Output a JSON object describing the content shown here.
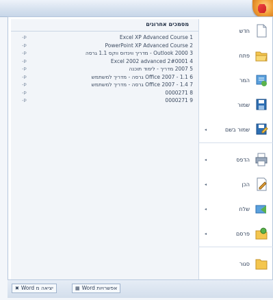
{
  "recent": {
    "header": "מסמכים אחרונים",
    "pin_label": "-Þ",
    "items": [
      {
        "num": "1",
        "text": "Excel XP Advanced Course"
      },
      {
        "num": "2",
        "text": "PowerPoint XP Advanced Course"
      },
      {
        "num": "3",
        "text": "Outlook 2000 - מדריך ווינדוס ווקס 1.1 גרסה"
      },
      {
        "num": "4",
        "text": "Excel 2002 advanced 2#0001"
      },
      {
        "num": "5",
        "text": "2007 מדריך - לימוד תוכנה"
      },
      {
        "num": "6",
        "text": "Office 2007 - 1.1 גרסה - מדריך למשתמש"
      },
      {
        "num": "7",
        "text": "Office 2007 - 1.4 גרסה - מדריך למשתמש"
      },
      {
        "num": "8",
        "text": "0000271"
      },
      {
        "num": "9",
        "text": "0000271"
      }
    ]
  },
  "menu": {
    "items": [
      {
        "label": "חדש",
        "icon": "new-document-icon",
        "has_arrow": false
      },
      {
        "label": "פתח",
        "icon": "open-folder-icon",
        "has_arrow": false
      },
      {
        "label": "המר",
        "icon": "convert-icon",
        "has_arrow": false
      },
      {
        "label": "שמור",
        "icon": "save-icon",
        "has_arrow": false
      },
      {
        "label": "שמור בשם",
        "icon": "save-as-icon",
        "has_arrow": true
      },
      {
        "label": "הדפס",
        "icon": "print-icon",
        "has_arrow": true
      },
      {
        "label": "הכן",
        "icon": "prepare-icon",
        "has_arrow": true
      },
      {
        "label": "שלח",
        "icon": "send-icon",
        "has_arrow": true
      },
      {
        "label": "פרסם",
        "icon": "publish-icon",
        "has_arrow": true
      },
      {
        "label": "סגור",
        "icon": "close-folder-icon",
        "has_arrow": false
      }
    ]
  },
  "bottom": {
    "options_label": "Word אפשרויות",
    "exit_label": "Word יציאה מ"
  },
  "colors": {
    "accent": "#f2a23a",
    "frame": "#b5c6dc",
    "panel": "#f2f5f9"
  }
}
